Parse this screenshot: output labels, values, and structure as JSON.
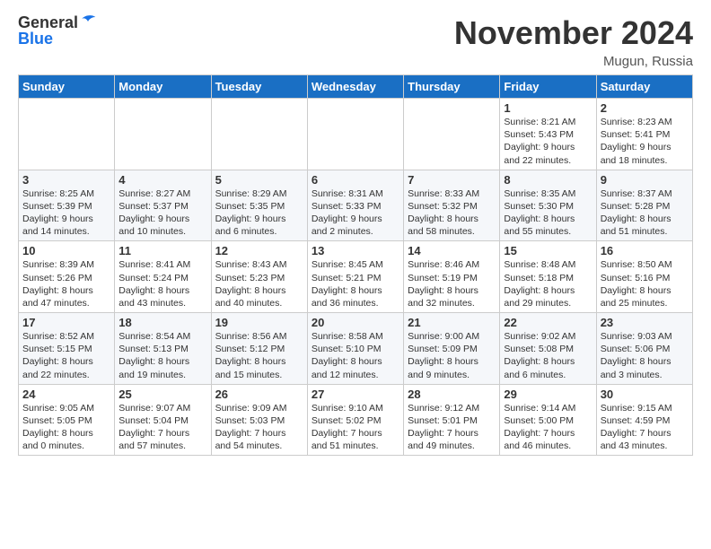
{
  "header": {
    "logo_line1": "General",
    "logo_line2": "Blue",
    "month": "November 2024",
    "location": "Mugun, Russia"
  },
  "weekdays": [
    "Sunday",
    "Monday",
    "Tuesday",
    "Wednesday",
    "Thursday",
    "Friday",
    "Saturday"
  ],
  "weeks": [
    [
      {
        "day": "",
        "detail": ""
      },
      {
        "day": "",
        "detail": ""
      },
      {
        "day": "",
        "detail": ""
      },
      {
        "day": "",
        "detail": ""
      },
      {
        "day": "",
        "detail": ""
      },
      {
        "day": "1",
        "detail": "Sunrise: 8:21 AM\nSunset: 5:43 PM\nDaylight: 9 hours\nand 22 minutes."
      },
      {
        "day": "2",
        "detail": "Sunrise: 8:23 AM\nSunset: 5:41 PM\nDaylight: 9 hours\nand 18 minutes."
      }
    ],
    [
      {
        "day": "3",
        "detail": "Sunrise: 8:25 AM\nSunset: 5:39 PM\nDaylight: 9 hours\nand 14 minutes."
      },
      {
        "day": "4",
        "detail": "Sunrise: 8:27 AM\nSunset: 5:37 PM\nDaylight: 9 hours\nand 10 minutes."
      },
      {
        "day": "5",
        "detail": "Sunrise: 8:29 AM\nSunset: 5:35 PM\nDaylight: 9 hours\nand 6 minutes."
      },
      {
        "day": "6",
        "detail": "Sunrise: 8:31 AM\nSunset: 5:33 PM\nDaylight: 9 hours\nand 2 minutes."
      },
      {
        "day": "7",
        "detail": "Sunrise: 8:33 AM\nSunset: 5:32 PM\nDaylight: 8 hours\nand 58 minutes."
      },
      {
        "day": "8",
        "detail": "Sunrise: 8:35 AM\nSunset: 5:30 PM\nDaylight: 8 hours\nand 55 minutes."
      },
      {
        "day": "9",
        "detail": "Sunrise: 8:37 AM\nSunset: 5:28 PM\nDaylight: 8 hours\nand 51 minutes."
      }
    ],
    [
      {
        "day": "10",
        "detail": "Sunrise: 8:39 AM\nSunset: 5:26 PM\nDaylight: 8 hours\nand 47 minutes."
      },
      {
        "day": "11",
        "detail": "Sunrise: 8:41 AM\nSunset: 5:24 PM\nDaylight: 8 hours\nand 43 minutes."
      },
      {
        "day": "12",
        "detail": "Sunrise: 8:43 AM\nSunset: 5:23 PM\nDaylight: 8 hours\nand 40 minutes."
      },
      {
        "day": "13",
        "detail": "Sunrise: 8:45 AM\nSunset: 5:21 PM\nDaylight: 8 hours\nand 36 minutes."
      },
      {
        "day": "14",
        "detail": "Sunrise: 8:46 AM\nSunset: 5:19 PM\nDaylight: 8 hours\nand 32 minutes."
      },
      {
        "day": "15",
        "detail": "Sunrise: 8:48 AM\nSunset: 5:18 PM\nDaylight: 8 hours\nand 29 minutes."
      },
      {
        "day": "16",
        "detail": "Sunrise: 8:50 AM\nSunset: 5:16 PM\nDaylight: 8 hours\nand 25 minutes."
      }
    ],
    [
      {
        "day": "17",
        "detail": "Sunrise: 8:52 AM\nSunset: 5:15 PM\nDaylight: 8 hours\nand 22 minutes."
      },
      {
        "day": "18",
        "detail": "Sunrise: 8:54 AM\nSunset: 5:13 PM\nDaylight: 8 hours\nand 19 minutes."
      },
      {
        "day": "19",
        "detail": "Sunrise: 8:56 AM\nSunset: 5:12 PM\nDaylight: 8 hours\nand 15 minutes."
      },
      {
        "day": "20",
        "detail": "Sunrise: 8:58 AM\nSunset: 5:10 PM\nDaylight: 8 hours\nand 12 minutes."
      },
      {
        "day": "21",
        "detail": "Sunrise: 9:00 AM\nSunset: 5:09 PM\nDaylight: 8 hours\nand 9 minutes."
      },
      {
        "day": "22",
        "detail": "Sunrise: 9:02 AM\nSunset: 5:08 PM\nDaylight: 8 hours\nand 6 minutes."
      },
      {
        "day": "23",
        "detail": "Sunrise: 9:03 AM\nSunset: 5:06 PM\nDaylight: 8 hours\nand 3 minutes."
      }
    ],
    [
      {
        "day": "24",
        "detail": "Sunrise: 9:05 AM\nSunset: 5:05 PM\nDaylight: 8 hours\nand 0 minutes."
      },
      {
        "day": "25",
        "detail": "Sunrise: 9:07 AM\nSunset: 5:04 PM\nDaylight: 7 hours\nand 57 minutes."
      },
      {
        "day": "26",
        "detail": "Sunrise: 9:09 AM\nSunset: 5:03 PM\nDaylight: 7 hours\nand 54 minutes."
      },
      {
        "day": "27",
        "detail": "Sunrise: 9:10 AM\nSunset: 5:02 PM\nDaylight: 7 hours\nand 51 minutes."
      },
      {
        "day": "28",
        "detail": "Sunrise: 9:12 AM\nSunset: 5:01 PM\nDaylight: 7 hours\nand 49 minutes."
      },
      {
        "day": "29",
        "detail": "Sunrise: 9:14 AM\nSunset: 5:00 PM\nDaylight: 7 hours\nand 46 minutes."
      },
      {
        "day": "30",
        "detail": "Sunrise: 9:15 AM\nSunset: 4:59 PM\nDaylight: 7 hours\nand 43 minutes."
      }
    ]
  ]
}
